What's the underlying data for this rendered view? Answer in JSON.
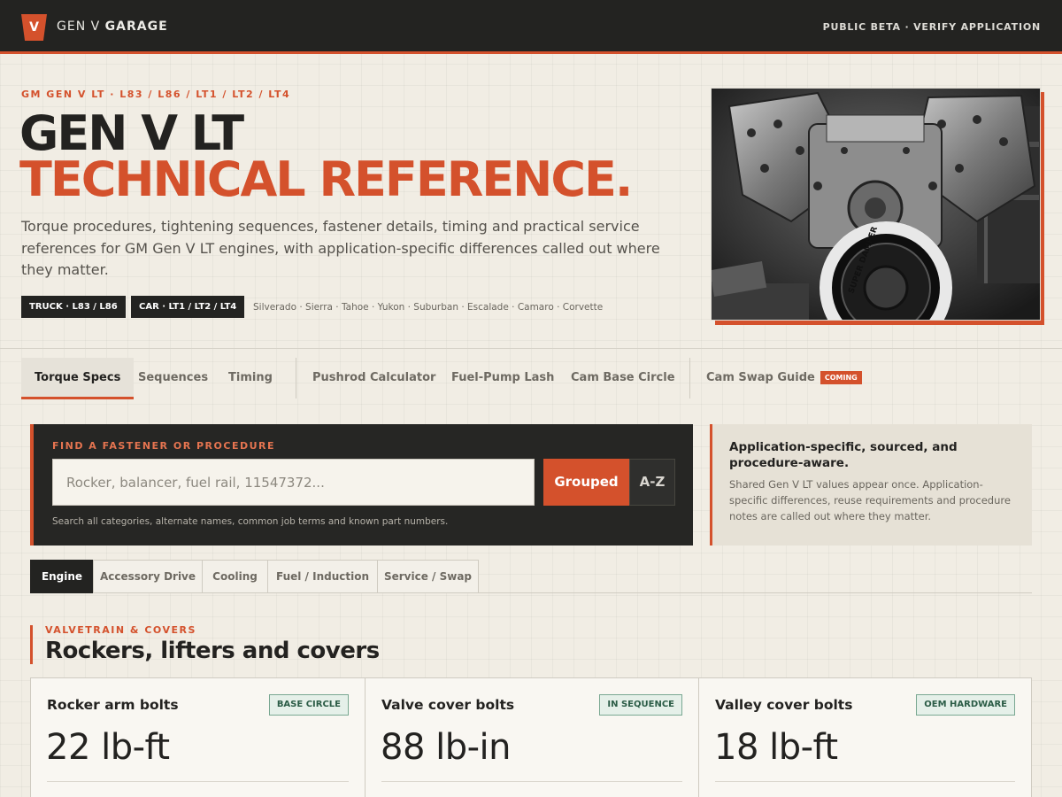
{
  "topbar": {
    "logo_letter": "V",
    "brand_prefix": "GEN V ",
    "brand_bold": "GARAGE",
    "status": "PUBLIC BETA · VERIFY APPLICATION"
  },
  "hero": {
    "eyebrow": "GM GEN V LT · L83 / L86 / LT1 / LT2 / LT4",
    "title_line1": "GEN V LT",
    "title_line2": "TECHNICAL REFERENCE.",
    "description": "Torque procedures, tightening sequences, fastener details, timing and practical service references for GM Gen V LT engines, with application-specific differences called out where they matter.",
    "tags": [
      "TRUCK · L83 / L86",
      "CAR · LT1 / LT2 / LT4"
    ],
    "applications": "Silverado · Sierra · Tahoe · Yukon · Suburban · Escalade · Camaro · Corvette",
    "image_text": "SUPER DAMPER"
  },
  "tool_nav": {
    "items": [
      "Torque Specs",
      "Sequences",
      "Timing",
      "Pushrod Calculator",
      "Fuel-Pump Lash",
      "Cam Base Circle",
      "Cam Swap Guide"
    ],
    "coming_badge": "COMING"
  },
  "search": {
    "label": "FIND A FASTENER OR PROCEDURE",
    "placeholder": "Rocker, balancer, fuel rail, 11547372...",
    "value": "",
    "grouped_label": "Grouped",
    "az_label": "A-Z",
    "help": "Search all categories, alternate names, common job terms and known part numbers."
  },
  "info_panel": {
    "title": "Application-specific, sourced, and procedure-aware.",
    "body": "Shared Gen V LT values appear once. Application-specific differences, reuse requirements and procedure notes are called out where they matter."
  },
  "category_tabs": [
    "Engine",
    "Accessory Drive",
    "Cooling",
    "Fuel / Induction",
    "Service / Swap"
  ],
  "section": {
    "eyebrow": "VALVETRAIN & COVERS",
    "title": "Rockers, lifters and covers"
  },
  "cards": [
    {
      "title": "Rocker arm bolts",
      "badge": "BASE CIRCLE",
      "value": "22 lb-ft",
      "note": ""
    },
    {
      "title": "Valve cover bolts",
      "badge": "IN SEQUENCE",
      "value": "88 lb-in",
      "note": ""
    },
    {
      "title": "Valley cover bolts",
      "badge": "OEM HARDWARE",
      "value": "18 lb-ft",
      "note": ""
    }
  ],
  "colors": {
    "accent": "#d4512c",
    "dark": "#232321",
    "background": "#f1ede4",
    "badge_green": "#2b5c46"
  }
}
